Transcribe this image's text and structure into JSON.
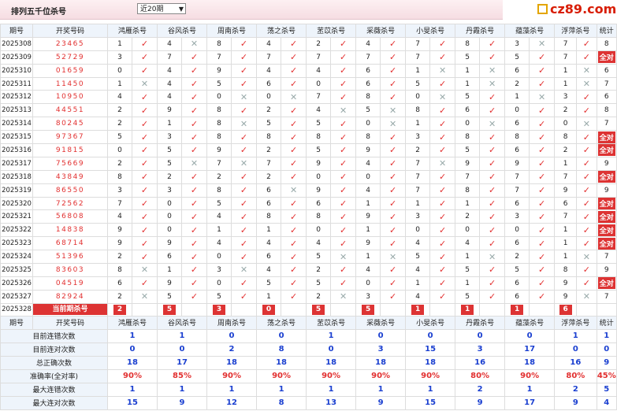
{
  "header": {
    "title": "排列五千位杀号",
    "period_select": "近20期",
    "logo": "cz89.com"
  },
  "columns": {
    "issue": "期号",
    "draw": "开奖号码",
    "stat": "统计"
  },
  "experts": [
    "鸿雁杀号",
    "谷风杀号",
    "周南杀号",
    "荡之杀号",
    "苤苡杀号",
    "采薇杀号",
    "小旻杀号",
    "丹霞杀号",
    "蕴藻杀号",
    "浮萍杀号"
  ],
  "rows": [
    {
      "issue": "2025308",
      "draw": "23465",
      "vals": [
        "1",
        "4",
        "8",
        "4",
        "2",
        "4",
        "7",
        "8",
        "3",
        "7"
      ],
      "ok": [
        1,
        0,
        1,
        1,
        1,
        1,
        1,
        1,
        0,
        1
      ],
      "stat": "8"
    },
    {
      "issue": "2025309",
      "draw": "52729",
      "vals": [
        "3",
        "7",
        "7",
        "7",
        "7",
        "7",
        "7",
        "5",
        "5",
        "7"
      ],
      "ok": [
        1,
        1,
        1,
        1,
        1,
        1,
        1,
        1,
        1,
        1
      ],
      "stat": "全对"
    },
    {
      "issue": "2025310",
      "draw": "01659",
      "vals": [
        "0",
        "4",
        "9",
        "4",
        "4",
        "6",
        "1",
        "1",
        "6",
        "1"
      ],
      "ok": [
        1,
        1,
        1,
        1,
        1,
        1,
        0,
        0,
        1,
        0
      ],
      "stat": "6"
    },
    {
      "issue": "2025311",
      "draw": "11450",
      "vals": [
        "1",
        "4",
        "5",
        "6",
        "0",
        "6",
        "5",
        "1",
        "2",
        "1"
      ],
      "ok": [
        0,
        1,
        1,
        1,
        1,
        1,
        1,
        0,
        1,
        0
      ],
      "stat": "7"
    },
    {
      "issue": "2025312",
      "draw": "10950",
      "vals": [
        "4",
        "4",
        "0",
        "0",
        "7",
        "8",
        "0",
        "5",
        "1",
        "3"
      ],
      "ok": [
        1,
        1,
        0,
        0,
        1,
        1,
        0,
        1,
        0,
        1
      ],
      "stat": "6"
    },
    {
      "issue": "2025313",
      "draw": "44551",
      "vals": [
        "2",
        "9",
        "8",
        "2",
        "4",
        "5",
        "8",
        "6",
        "0",
        "2"
      ],
      "ok": [
        1,
        1,
        1,
        1,
        0,
        0,
        1,
        1,
        1,
        1
      ],
      "stat": "8"
    },
    {
      "issue": "2025314",
      "draw": "80245",
      "vals": [
        "2",
        "1",
        "8",
        "5",
        "5",
        "0",
        "1",
        "0",
        "6",
        "0"
      ],
      "ok": [
        1,
        1,
        0,
        1,
        1,
        0,
        1,
        0,
        1,
        0
      ],
      "stat": "7"
    },
    {
      "issue": "2025315",
      "draw": "97367",
      "vals": [
        "5",
        "3",
        "8",
        "8",
        "8",
        "8",
        "3",
        "8",
        "8",
        "8"
      ],
      "ok": [
        1,
        1,
        1,
        1,
        1,
        1,
        1,
        1,
        1,
        1
      ],
      "stat": "全对"
    },
    {
      "issue": "2025316",
      "draw": "91815",
      "vals": [
        "0",
        "5",
        "9",
        "2",
        "5",
        "9",
        "2",
        "5",
        "6",
        "2"
      ],
      "ok": [
        1,
        1,
        1,
        1,
        1,
        1,
        1,
        1,
        1,
        1
      ],
      "stat": "全对"
    },
    {
      "issue": "2025317",
      "draw": "75669",
      "vals": [
        "2",
        "5",
        "7",
        "7",
        "9",
        "4",
        "7",
        "9",
        "9",
        "1"
      ],
      "ok": [
        1,
        0,
        0,
        1,
        1,
        1,
        0,
        1,
        1,
        1
      ],
      "stat": "9"
    },
    {
      "issue": "2025318",
      "draw": "43849",
      "vals": [
        "8",
        "2",
        "2",
        "2",
        "0",
        "0",
        "7",
        "7",
        "7",
        "7"
      ],
      "ok": [
        1,
        1,
        1,
        1,
        1,
        1,
        1,
        1,
        1,
        1
      ],
      "stat": "全对"
    },
    {
      "issue": "2025319",
      "draw": "86550",
      "vals": [
        "3",
        "3",
        "8",
        "6",
        "9",
        "4",
        "7",
        "8",
        "7",
        "9"
      ],
      "ok": [
        1,
        1,
        1,
        0,
        1,
        1,
        1,
        1,
        1,
        1
      ],
      "stat": "9"
    },
    {
      "issue": "2025320",
      "draw": "72562",
      "vals": [
        "7",
        "0",
        "5",
        "6",
        "6",
        "1",
        "1",
        "1",
        "6",
        "6"
      ],
      "ok": [
        1,
        1,
        1,
        1,
        1,
        1,
        1,
        1,
        1,
        1
      ],
      "stat": "全对"
    },
    {
      "issue": "2025321",
      "draw": "56808",
      "vals": [
        "4",
        "0",
        "4",
        "8",
        "8",
        "9",
        "3",
        "2",
        "3",
        "7"
      ],
      "ok": [
        1,
        1,
        1,
        1,
        1,
        1,
        1,
        1,
        1,
        1
      ],
      "stat": "全对"
    },
    {
      "issue": "2025322",
      "draw": "14838",
      "vals": [
        "9",
        "0",
        "1",
        "1",
        "0",
        "1",
        "0",
        "0",
        "0",
        "1"
      ],
      "ok": [
        1,
        1,
        1,
        1,
        1,
        1,
        1,
        1,
        1,
        1
      ],
      "stat": "全对"
    },
    {
      "issue": "2025323",
      "draw": "68714",
      "vals": [
        "9",
        "9",
        "4",
        "4",
        "4",
        "9",
        "4",
        "4",
        "6",
        "1"
      ],
      "ok": [
        1,
        1,
        1,
        1,
        1,
        1,
        1,
        1,
        1,
        1
      ],
      "stat": "全对"
    },
    {
      "issue": "2025324",
      "draw": "51396",
      "vals": [
        "2",
        "6",
        "0",
        "6",
        "5",
        "1",
        "5",
        "1",
        "2",
        "1"
      ],
      "ok": [
        1,
        1,
        1,
        1,
        0,
        0,
        1,
        0,
        1,
        0
      ],
      "stat": "7"
    },
    {
      "issue": "2025325",
      "draw": "83603",
      "vals": [
        "8",
        "1",
        "3",
        "4",
        "2",
        "4",
        "4",
        "5",
        "5",
        "8"
      ],
      "ok": [
        0,
        1,
        0,
        1,
        1,
        1,
        1,
        1,
        1,
        1
      ],
      "stat": "9"
    },
    {
      "issue": "2025326",
      "draw": "04519",
      "vals": [
        "6",
        "9",
        "0",
        "5",
        "5",
        "0",
        "1",
        "1",
        "6",
        "9"
      ],
      "ok": [
        1,
        1,
        1,
        1,
        1,
        1,
        1,
        1,
        1,
        1
      ],
      "stat": "全对"
    },
    {
      "issue": "2025327",
      "draw": "82924",
      "vals": [
        "2",
        "5",
        "5",
        "1",
        "2",
        "3",
        "4",
        "5",
        "6",
        "9"
      ],
      "ok": [
        0,
        1,
        1,
        1,
        0,
        1,
        1,
        1,
        1,
        0
      ],
      "stat": "7"
    }
  ],
  "current": {
    "issue": "2025328",
    "label": "当前期杀号",
    "vals": [
      "2",
      "5",
      "3",
      "0",
      "5",
      "5",
      "1",
      "1",
      "1",
      "6"
    ]
  },
  "stats": [
    {
      "label": "目前连错次数",
      "vals": [
        "1",
        "1",
        "0",
        "0",
        "1",
        "0",
        "0",
        "0",
        "0",
        "1"
      ],
      "total": "1"
    },
    {
      "label": "目前连对次数",
      "vals": [
        "0",
        "0",
        "2",
        "8",
        "0",
        "3",
        "15",
        "3",
        "17",
        "0"
      ],
      "total": "0"
    },
    {
      "label": "总正确次数",
      "vals": [
        "18",
        "17",
        "18",
        "18",
        "18",
        "18",
        "18",
        "16",
        "18",
        "16"
      ],
      "total": "9"
    },
    {
      "label": "准确率(全对率)",
      "vals": [
        "90%",
        "85%",
        "90%",
        "90%",
        "90%",
        "90%",
        "90%",
        "80%",
        "90%",
        "80%"
      ],
      "total": "45%"
    },
    {
      "label": "最大连错次数",
      "vals": [
        "1",
        "1",
        "1",
        "1",
        "1",
        "1",
        "1",
        "2",
        "1",
        "2"
      ],
      "total": "5"
    },
    {
      "label": "最大连对次数",
      "vals": [
        "15",
        "9",
        "12",
        "8",
        "13",
        "9",
        "15",
        "9",
        "17",
        "9"
      ],
      "total": "4"
    }
  ]
}
